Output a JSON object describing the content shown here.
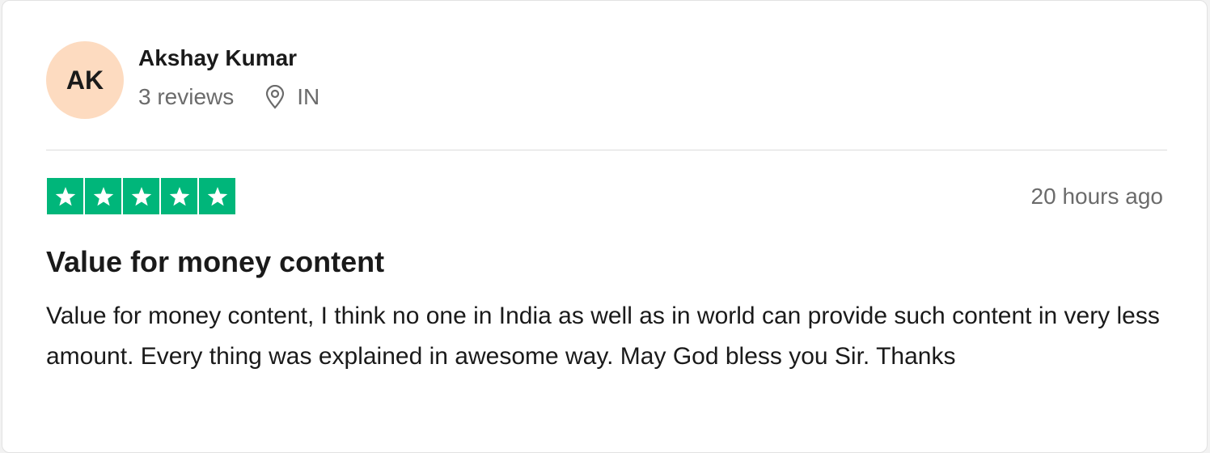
{
  "consumer": {
    "initials": "AK",
    "name": "Akshay Kumar",
    "reviews_count": "3 reviews",
    "country": "IN",
    "avatar_color": "#fddbc0"
  },
  "review": {
    "rating": 5,
    "rating_max": 5,
    "star_color": "#00b67a",
    "timestamp": "20 hours ago",
    "title": "Value for money content",
    "text": "Value for money content, I think no one in India as well as in world can provide such content in very less amount. Every thing was explained in awesome way. May God bless you Sir. Thanks"
  },
  "icons": {
    "location": "map-pin-icon",
    "star": "star-icon"
  }
}
